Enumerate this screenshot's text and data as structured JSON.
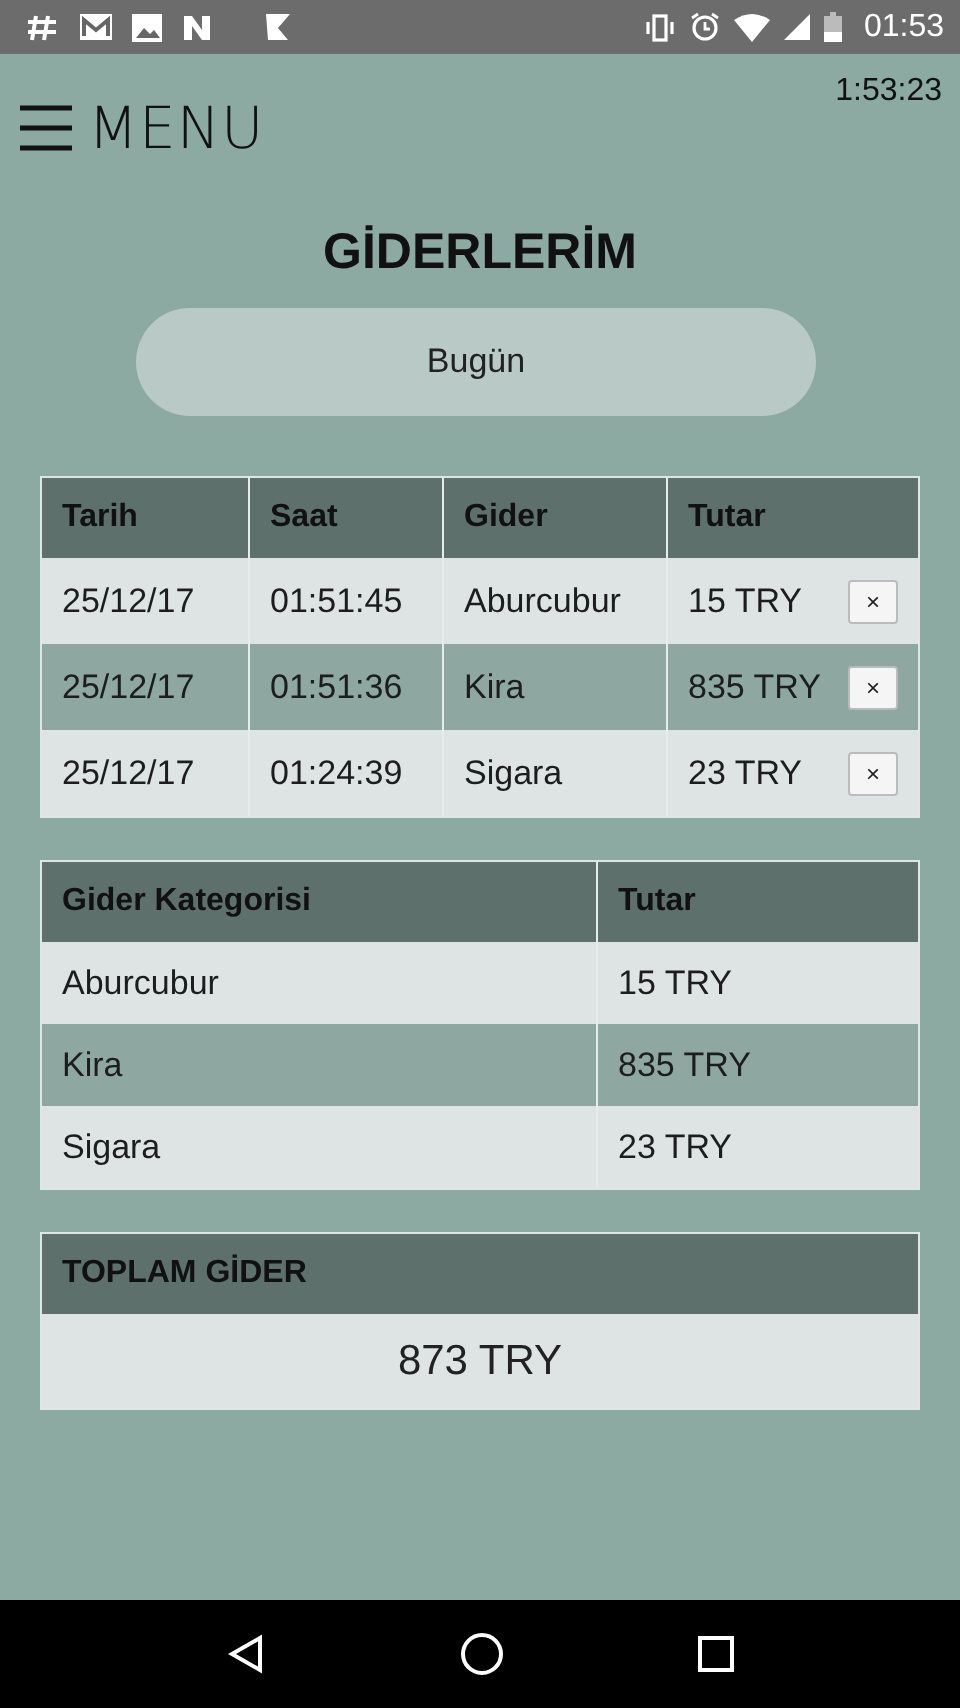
{
  "status_bar": {
    "time": "01:53"
  },
  "header": {
    "menu_label": "MENU",
    "clock": "1:53:23"
  },
  "title": "GİDERLERİM",
  "date_button": "Bugün",
  "expenses": {
    "columns": [
      "Tarih",
      "Saat",
      "Gider",
      "Tutar"
    ],
    "rows": [
      {
        "date": "25/12/17",
        "time": "01:51:45",
        "item": "Aburcubur",
        "amount": "15 TRY",
        "delete": "×"
      },
      {
        "date": "25/12/17",
        "time": "01:51:36",
        "item": "Kira",
        "amount": "835 TRY",
        "delete": "×"
      },
      {
        "date": "25/12/17",
        "time": "01:24:39",
        "item": "Sigara",
        "amount": "23 TRY",
        "delete": "×"
      }
    ]
  },
  "categories": {
    "columns": [
      "Gider Kategorisi",
      "Tutar"
    ],
    "rows": [
      {
        "category": "Aburcubur",
        "amount": "15 TRY"
      },
      {
        "category": "Kira",
        "amount": "835 TRY"
      },
      {
        "category": "Sigara",
        "amount": "23 TRY"
      }
    ]
  },
  "total": {
    "label": "TOPLAM GİDER",
    "value": "873 TRY"
  }
}
